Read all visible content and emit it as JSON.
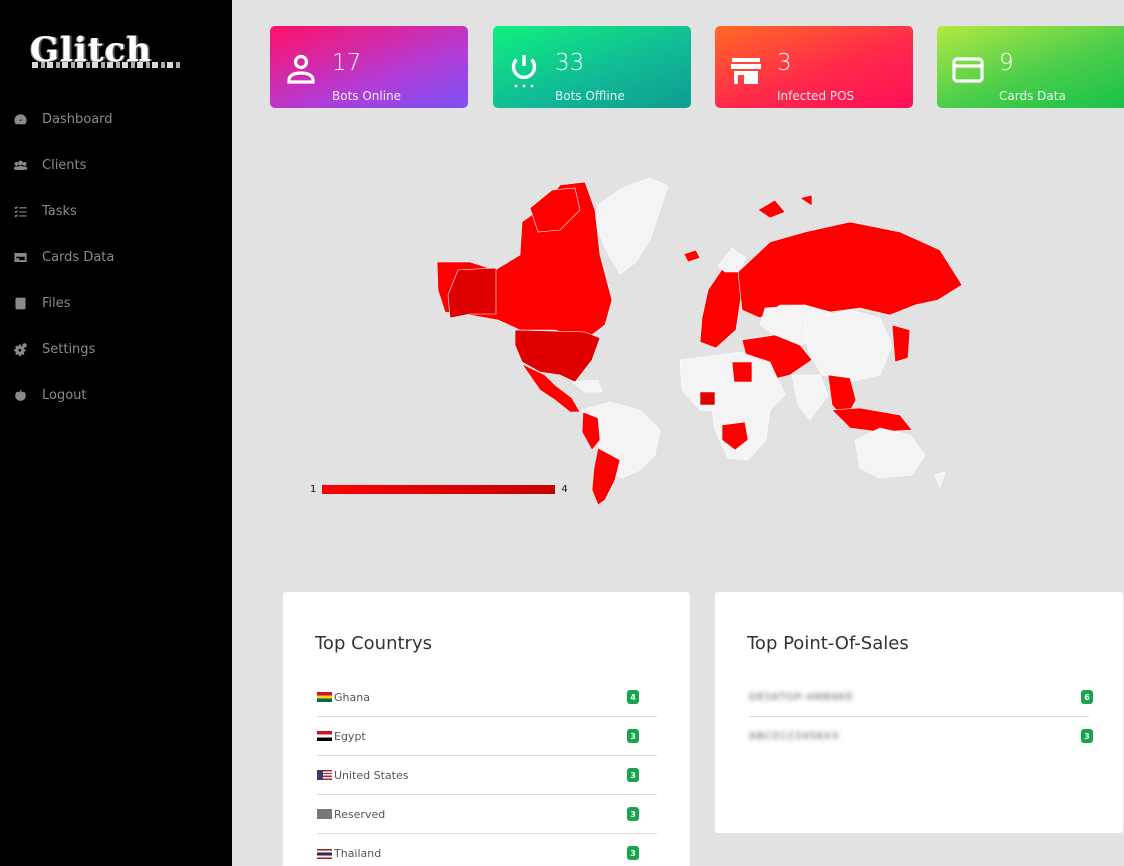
{
  "app": {
    "logo_text": "Glitch"
  },
  "sidebar": {
    "items": [
      {
        "label": "Dashboard",
        "icon": "tachometer-icon"
      },
      {
        "label": "Clients",
        "icon": "users-icon"
      },
      {
        "label": "Tasks",
        "icon": "tasks-icon"
      },
      {
        "label": "Cards Data",
        "icon": "credit-card-icon"
      },
      {
        "label": "Files",
        "icon": "file-icon"
      },
      {
        "label": "Settings",
        "icon": "cogs-icon"
      },
      {
        "label": "Logout",
        "icon": "power-icon"
      }
    ]
  },
  "stats": [
    {
      "value": "17",
      "label": "Bots Online",
      "icon": "user-icon"
    },
    {
      "value": "33",
      "label": "Bots Offline",
      "icon": "power-icon"
    },
    {
      "value": "3",
      "label": "Infected POS",
      "icon": "store-icon"
    },
    {
      "value": "9",
      "label": "Cards Data",
      "icon": "credit-card-icon"
    }
  ],
  "map": {
    "legend_min": "1",
    "legend_max": "4",
    "colors": {
      "infected": "#ff0000",
      "high": "#e00000",
      "land": "#f4f4f4",
      "ocean": "#e2e2e2"
    }
  },
  "top_countries": {
    "title": "Top Countrys",
    "rows": [
      {
        "name": "Ghana",
        "count": "4",
        "flag": "ghana-flag"
      },
      {
        "name": "Egypt",
        "count": "3",
        "flag": "egypt-flag"
      },
      {
        "name": "United States",
        "count": "3",
        "flag": "us-flag"
      },
      {
        "name": "Reserved",
        "count": "3",
        "flag": "unknown-flag"
      },
      {
        "name": "Thailand",
        "count": "3",
        "flag": "thailand-flag"
      }
    ]
  },
  "top_pos": {
    "title": "Top Point-Of-Sales",
    "rows": [
      {
        "name": "DESKTOP-4MB9KE",
        "count": "6"
      },
      {
        "name": "ABC0123456XX",
        "count": "3"
      }
    ]
  }
}
